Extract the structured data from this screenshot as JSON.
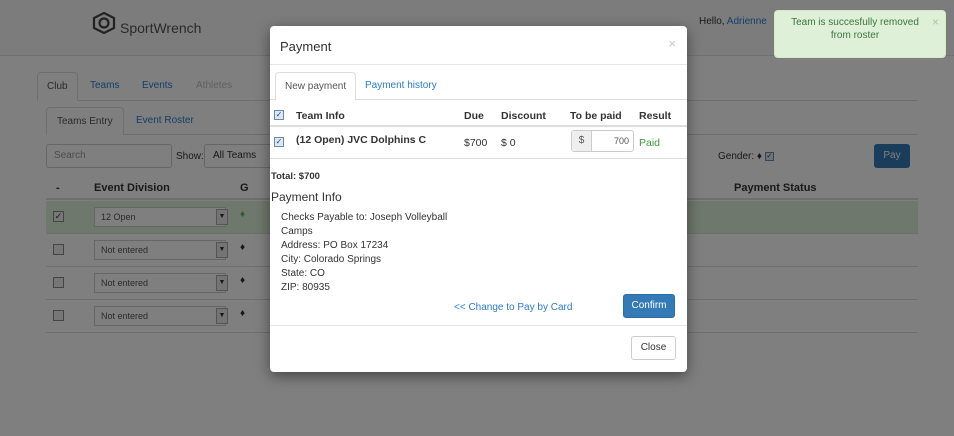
{
  "app": {
    "brand": "SportWrench"
  },
  "header": {
    "greeting_prefix": "Hello, ",
    "user_name": "Adrienne"
  },
  "toast": {
    "message": "Team is succesfully removed from roster",
    "close": "×"
  },
  "main_tabs": [
    {
      "label": "Club"
    },
    {
      "label": "Teams"
    },
    {
      "label": "Events"
    },
    {
      "label": "Athletes"
    }
  ],
  "sub_tabs": [
    {
      "label": "Teams Entry"
    },
    {
      "label": "Event Roster"
    }
  ],
  "filters": {
    "search_placeholder": "Search",
    "show_label": "Show:",
    "show_value": "All Teams",
    "gender_label": "Gender:",
    "pay_button": "Pay"
  },
  "table": {
    "headers": {
      "select": "-",
      "division": "Event Division",
      "g": "G",
      "payment_status": "Payment Status"
    },
    "rows": [
      {
        "checked": "✓",
        "division": "12 Open"
      },
      {
        "checked": "",
        "division": "Not entered"
      },
      {
        "checked": "",
        "division": "Not entered"
      },
      {
        "checked": "",
        "division": "Not entered"
      }
    ]
  },
  "modal": {
    "title": "Payment",
    "close_x": "×",
    "tabs": [
      {
        "label": "New payment"
      },
      {
        "label": "Payment history"
      }
    ],
    "headers": {
      "team_info": "Team Info",
      "due": "Due",
      "discount": "Discount",
      "to_be_paid": "To be paid",
      "result": "Result"
    },
    "row": {
      "team": "(12 Open) JVC Dolphins C",
      "due": "$700",
      "discount": "$ 0",
      "currency": "$",
      "amount": "700",
      "result": "Paid"
    },
    "total": "Total: $700",
    "payment_info_title": "Payment Info",
    "payment_info": [
      "Checks Payable to: Joseph Volleyball",
      "Camps",
      "Address: PO Box 17234",
      "City: Colorado Springs",
      "State: CO",
      "ZIP: 80935"
    ],
    "change_link": "<< Change to Pay by Card",
    "confirm_button": "Confirm",
    "close_button": "Close"
  },
  "colors": {
    "primary": "#337ab7",
    "success_bg": "#dff0d8",
    "success_text": "#3c763d",
    "link": "#2a7bd0"
  }
}
